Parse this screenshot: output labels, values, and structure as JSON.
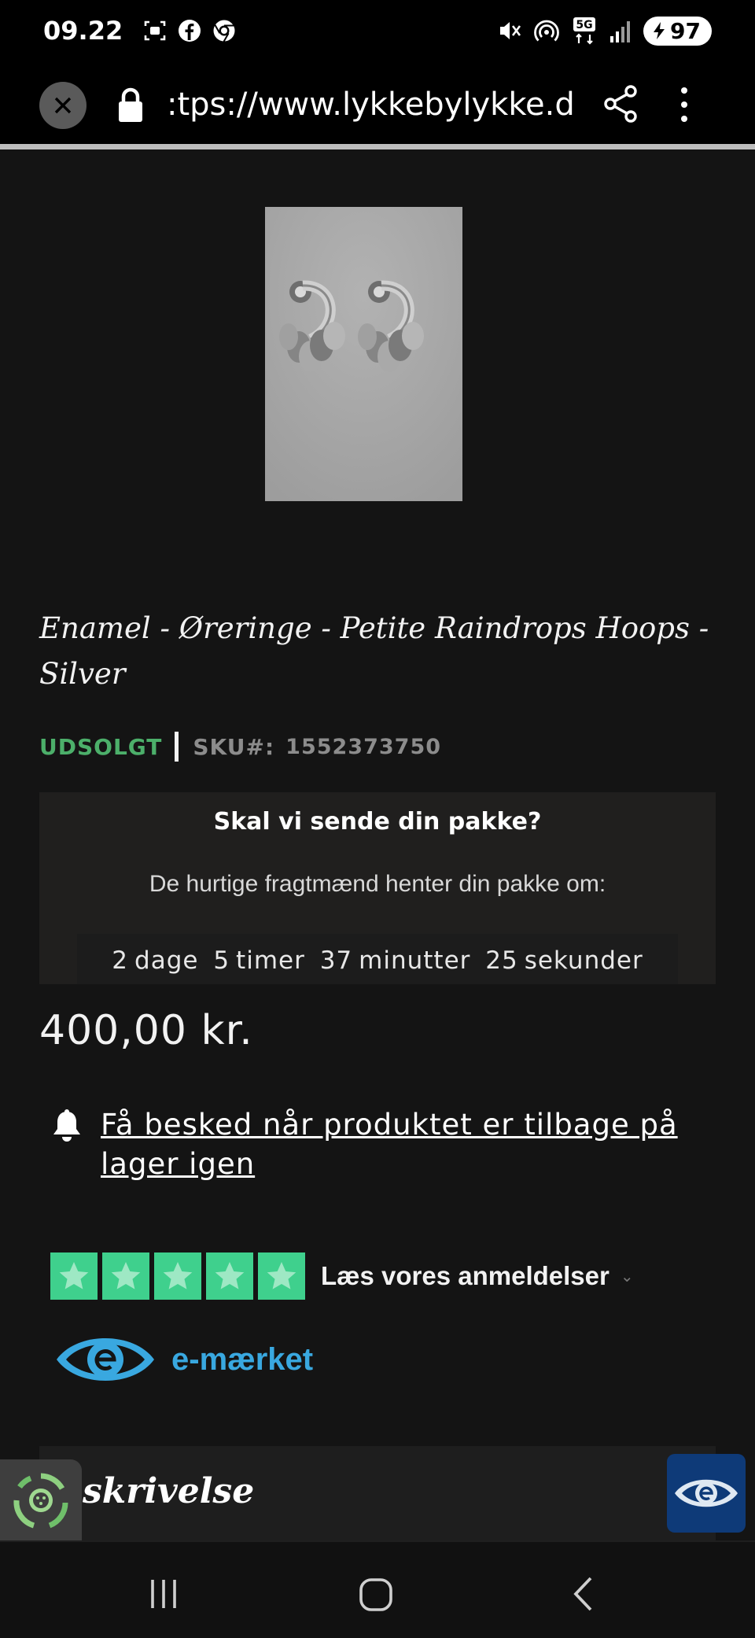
{
  "status_bar": {
    "time": "09.22",
    "battery": "97",
    "network": "5G",
    "icons": [
      "screenshot-icon",
      "facebook-icon",
      "chrome-icon",
      "mute-icon",
      "hotspot-icon",
      "signal-icon"
    ]
  },
  "browser": {
    "url": ":tps://www.lykkebylykke.dk/e",
    "icons": [
      "close-icon",
      "lock-icon",
      "share-icon",
      "more-vert-icon"
    ]
  },
  "product": {
    "image_desc_icon": "earrings-image",
    "title": "Enamel - Øreringe - Petite Raindrops Hoops - Silver",
    "stock_status": "UDSOLGT",
    "sku_label": "SKU#:",
    "sku_value": "1552373750",
    "price": "400,00 kr."
  },
  "shipping": {
    "title": "Skal vi sende din pakke?",
    "subtitle": "De hurtige fragtmænd henter din pakke om:",
    "countdown": {
      "days_value": "2",
      "days_label": "dage",
      "hours_value": "5",
      "hours_label": "timer",
      "minutes_value": "37",
      "minutes_label": "minutter",
      "seconds_value": "25",
      "seconds_label": "sekunder"
    }
  },
  "notify": {
    "label": "Få besked når produktet er tilbage på lager igen"
  },
  "trustpilot": {
    "stars": 5,
    "label": "Læs vores anmeldelser",
    "color": "#3fd08d"
  },
  "emaerket": {
    "label": "e-mærket",
    "color": "#39a8e0"
  },
  "description": {
    "title": "skrivelse"
  },
  "colors": {
    "background": "#141414",
    "stock_green": "#4caf6a",
    "badge_blue": "#0e3a78"
  },
  "nav_bar": {
    "icons": [
      "recents-icon",
      "home-icon",
      "back-icon"
    ]
  }
}
